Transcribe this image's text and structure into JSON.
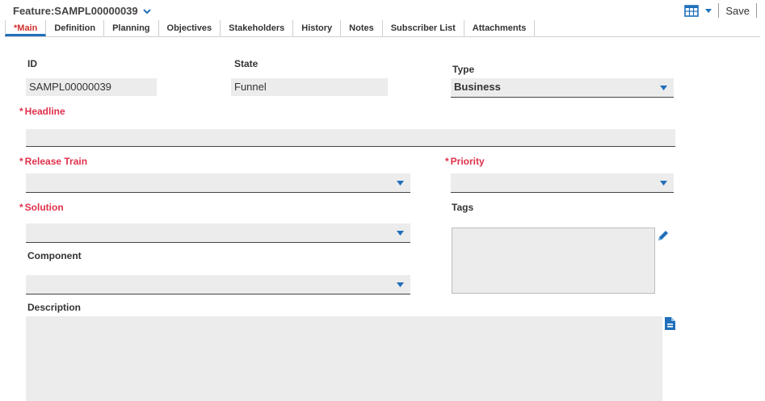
{
  "header": {
    "title": "Feature:SAMPL00000039",
    "save_label": "Save"
  },
  "tabs": [
    {
      "label": "*Main"
    },
    {
      "label": "Definition"
    },
    {
      "label": "Planning"
    },
    {
      "label": "Objectives"
    },
    {
      "label": "Stakeholders"
    },
    {
      "label": "History"
    },
    {
      "label": "Notes"
    },
    {
      "label": "Subscriber List"
    },
    {
      "label": "Attachments"
    }
  ],
  "form": {
    "id_label": "ID",
    "id_value": "SAMPL00000039",
    "state_label": "State",
    "state_value": "Funnel",
    "type_label": "Type",
    "type_value": "Business",
    "headline_label": "Headline",
    "headline_value": "",
    "release_train_label": "Release Train",
    "release_train_value": "",
    "priority_label": "Priority",
    "priority_value": "",
    "solution_label": "Solution",
    "solution_value": "",
    "tags_label": "Tags",
    "component_label": "Component",
    "component_value": "",
    "description_label": "Description"
  },
  "colors": {
    "required": "#e0314b",
    "active_tab_text": "#d0312d",
    "active_tab_underline": "#1f6fba",
    "icon_blue": "#1f6fba"
  },
  "icons": {
    "title_dropdown": "chevron-down-icon",
    "layout": "calendar-icon",
    "tags_edit": "pencil-icon",
    "description": "document-icon"
  }
}
